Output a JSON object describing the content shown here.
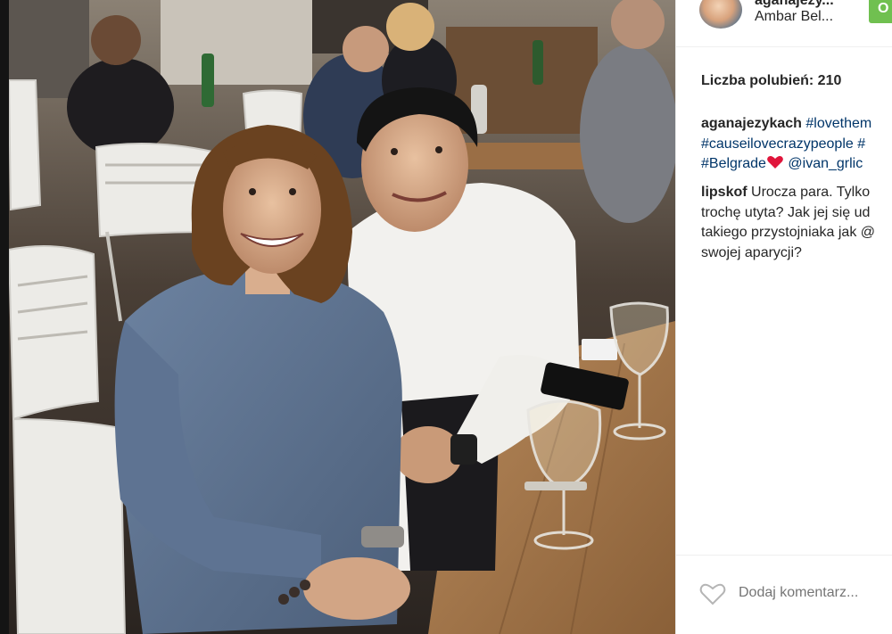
{
  "post": {
    "author_username": "aganajezy...",
    "author_fullname": "Ambar Bel...",
    "follow_label": "O"
  },
  "likes_label": "Liczba polubień: 210",
  "comments": [
    {
      "username": "aganajezykach",
      "text_line1": "#lovethem",
      "text_line2": "#causeilovecrazypeople #",
      "text_line3_tag": "#Belgrade",
      "text_line3_mention": "@ivan_grlic"
    },
    {
      "username": "lipskof",
      "text_line1": "Urocza para. Tylko",
      "text_line2": "trochę utyta? Jak jej się ud",
      "text_line3": "takiego przystojniaka jak @",
      "text_line4": "swojej aparycji?"
    }
  ],
  "footer": {
    "like_icon": "heart-outline-icon",
    "comment_placeholder": "Dodaj komentarz..."
  },
  "colors": {
    "text": "#262626",
    "hashtag": "#003569",
    "placeholder": "#a6a6a6",
    "follow_button": "#70c050",
    "heart_emoji": "#e0153b"
  }
}
